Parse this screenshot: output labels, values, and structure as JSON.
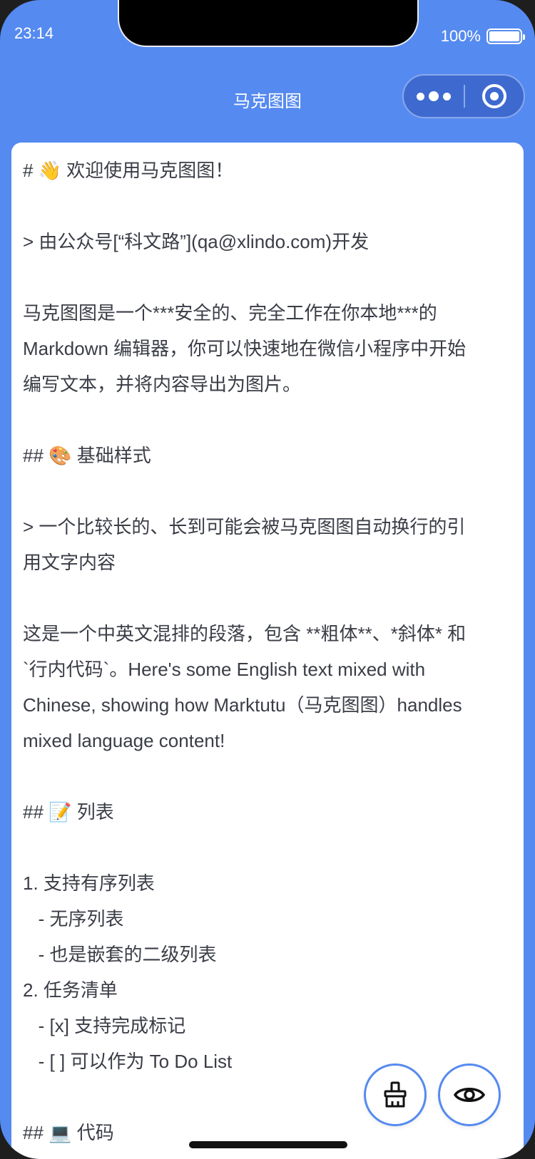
{
  "status_bar": {
    "time": "23:14",
    "battery": "100%",
    "battery_level": 1.0
  },
  "nav": {
    "title": "马克图图",
    "more_icon": "more-dots-icon",
    "close_icon": "target-circle-icon"
  },
  "editor": {
    "lines": [
      "# 👋 欢迎使用马克图图！",
      "",
      "> 由公众号[“科文路”](qa@xlindo.com)开发",
      "",
      "马克图图是一个***安全的、完全工作在你本地***的",
      "Markdown 编辑器，你可以快速地在微信小程序中开始",
      "编写文本，并将内容导出为图片。",
      "",
      "## 🎨 基础样式",
      "",
      "> 一个比较长的、长到可能会被马克图图自动换行的引",
      "用文字内容",
      "",
      "这是一个中英文混排的段落，包含 **粗体**、*斜体* 和",
      "`行内代码`。Here's some English text mixed with",
      "Chinese, showing how Marktutu（马克图图）handles",
      "mixed language content!",
      "",
      "## 📝 列表",
      "",
      "1. 支持有序列表",
      "   - 无序列表",
      "   - 也是嵌套的二级列表",
      "2. 任务清单",
      "   - [x] 支持完成标记",
      "   - [ ] 可以作为 To Do List",
      "",
      "## 💻 代码"
    ]
  },
  "actions": {
    "clear_icon": "broom-icon",
    "preview_icon": "eye-icon"
  },
  "colors": {
    "brand": "#558af0",
    "text": "#3a3d46"
  }
}
